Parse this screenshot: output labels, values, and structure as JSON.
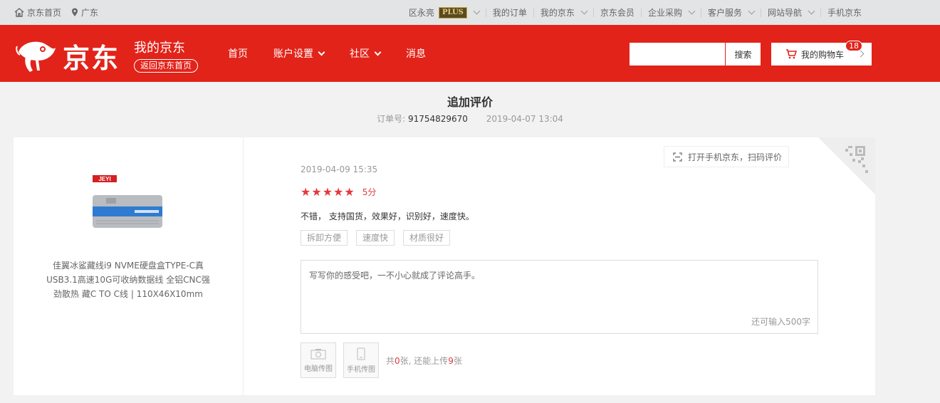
{
  "topbar": {
    "home": "京东首页",
    "location": "广东",
    "user": "区永亮",
    "plus_badge": "PLUS",
    "links": [
      "我的订单",
      "我的京东",
      "京东会员",
      "企业采购",
      "客户服务",
      "网站导航",
      "手机京东"
    ]
  },
  "header": {
    "logo_text": "京东",
    "section_title": "我的京东",
    "back_home": "返回京东首页",
    "nav": [
      "首页",
      "账户设置",
      "社区",
      "消息"
    ],
    "search_button": "搜索",
    "search_placeholder": "",
    "cart_label": "我的购物车",
    "cart_count": "18"
  },
  "page": {
    "title": "追加评价",
    "order_label": "订单号:",
    "order_no": "91754829670",
    "order_date": "2019-04-07 13:04"
  },
  "product": {
    "brand": "JEYI",
    "name": "佳翼冰鲨藏线i9 NVME硬盘盒TYPE-C真USB3.1高速10G可收纳数据线 全铝CNC强劲散热 藏C TO C线 | 110X46X10mm"
  },
  "review": {
    "date": "2019-04-09 15:35",
    "stars": 5,
    "score": "5分",
    "text": "不错， 支持国货，效果好，识别好，速度快。",
    "tags": [
      "拆卸方便",
      "速度快",
      "材质很好"
    ],
    "qr_tip": "打开手机京东，扫码评价",
    "textarea_placeholder": "写写你的感受吧，一不小心就成了评论高手。",
    "char_remaining": "还可输入500字",
    "upload_pc": "电脑传图",
    "upload_mobile": "手机传图",
    "upload_info_prefix": "共",
    "upload_count": "0",
    "upload_info_mid": "张, 还能上传",
    "upload_left": "9",
    "upload_info_suffix": "张"
  },
  "colors": {
    "brand_red": "#e2231a",
    "star_red": "#e4393c"
  }
}
